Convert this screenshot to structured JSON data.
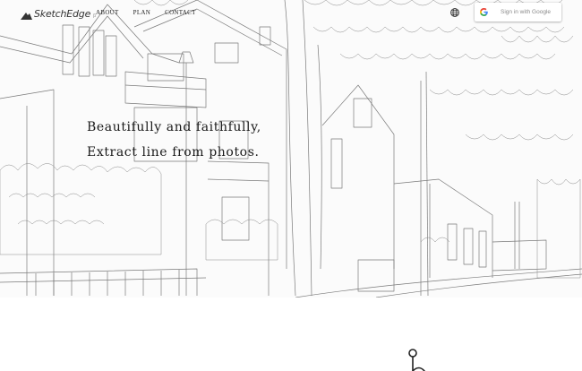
{
  "brand": {
    "name": "SketchEdge",
    "tag": "β"
  },
  "nav": {
    "items": [
      {
        "label": "ABOUT"
      },
      {
        "label": "PLAN"
      },
      {
        "label": "CONTACT"
      }
    ]
  },
  "header": {
    "language_icon": "globe-icon",
    "signin_label": "Sign in with Google",
    "signin_icon": "google-g-icon"
  },
  "hero": {
    "line1": "Beautifully and faithfully,",
    "line2": "Extract line from photos.",
    "background": "line-drawing-street-houses-trees"
  },
  "colors": {
    "background": "#ffffff",
    "text": "#1a1a1a",
    "sketch_line": "#6b6b6b"
  }
}
